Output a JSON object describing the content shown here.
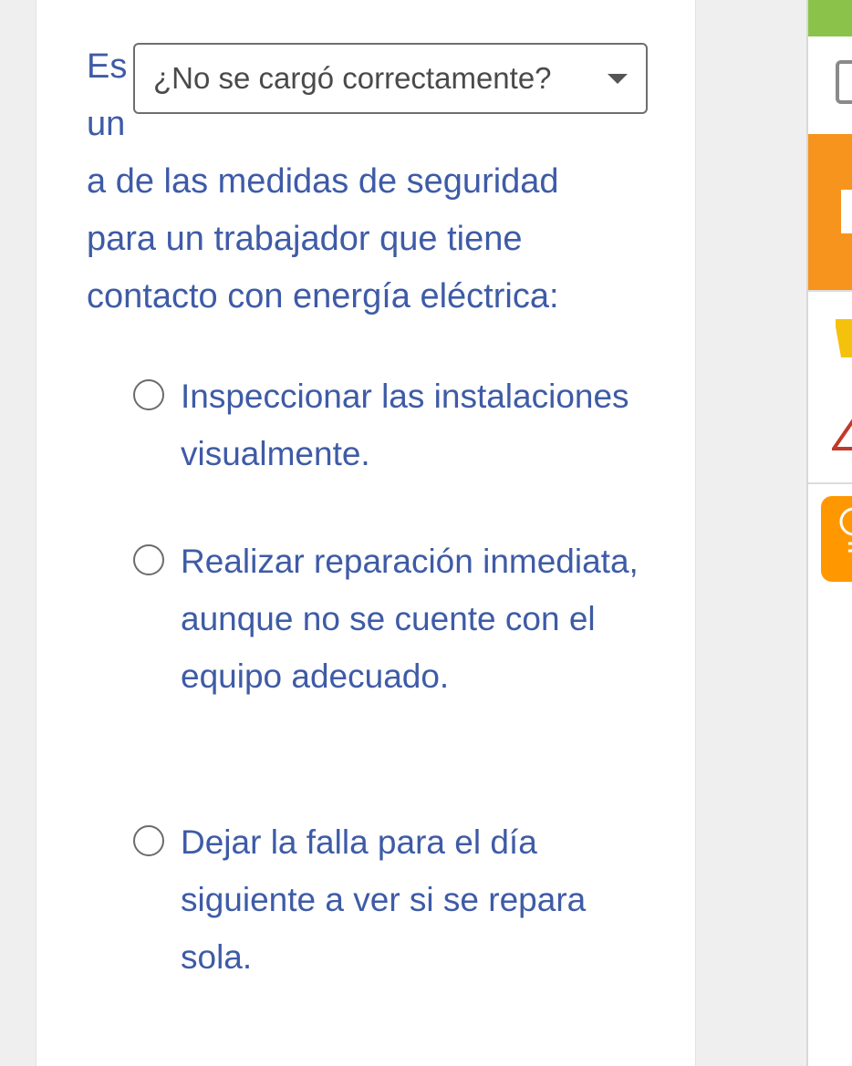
{
  "question": {
    "lead_word": "Es",
    "line2": "un",
    "line3": "a de las medidas de seguridad",
    "line4": "para un trabajador que tiene",
    "line5": "contacto con energía eléctrica:"
  },
  "dropdown": {
    "label": "¿No se cargó correctamente?"
  },
  "options": [
    {
      "label": "Inspeccionar las instalaciones visualmente."
    },
    {
      "label": "Realizar reparación inmediata, aunque no se cuente con el equipo adecuado."
    },
    {
      "label": "Dejar la falla para el día siguiente a ver si se repara sola."
    }
  ],
  "colors": {
    "text": "#3e5ba6",
    "green": "#8bc34a",
    "orange": "#f7941d",
    "yellow": "#f4c20d",
    "red": "#c0392b",
    "amber": "#ff9800"
  }
}
